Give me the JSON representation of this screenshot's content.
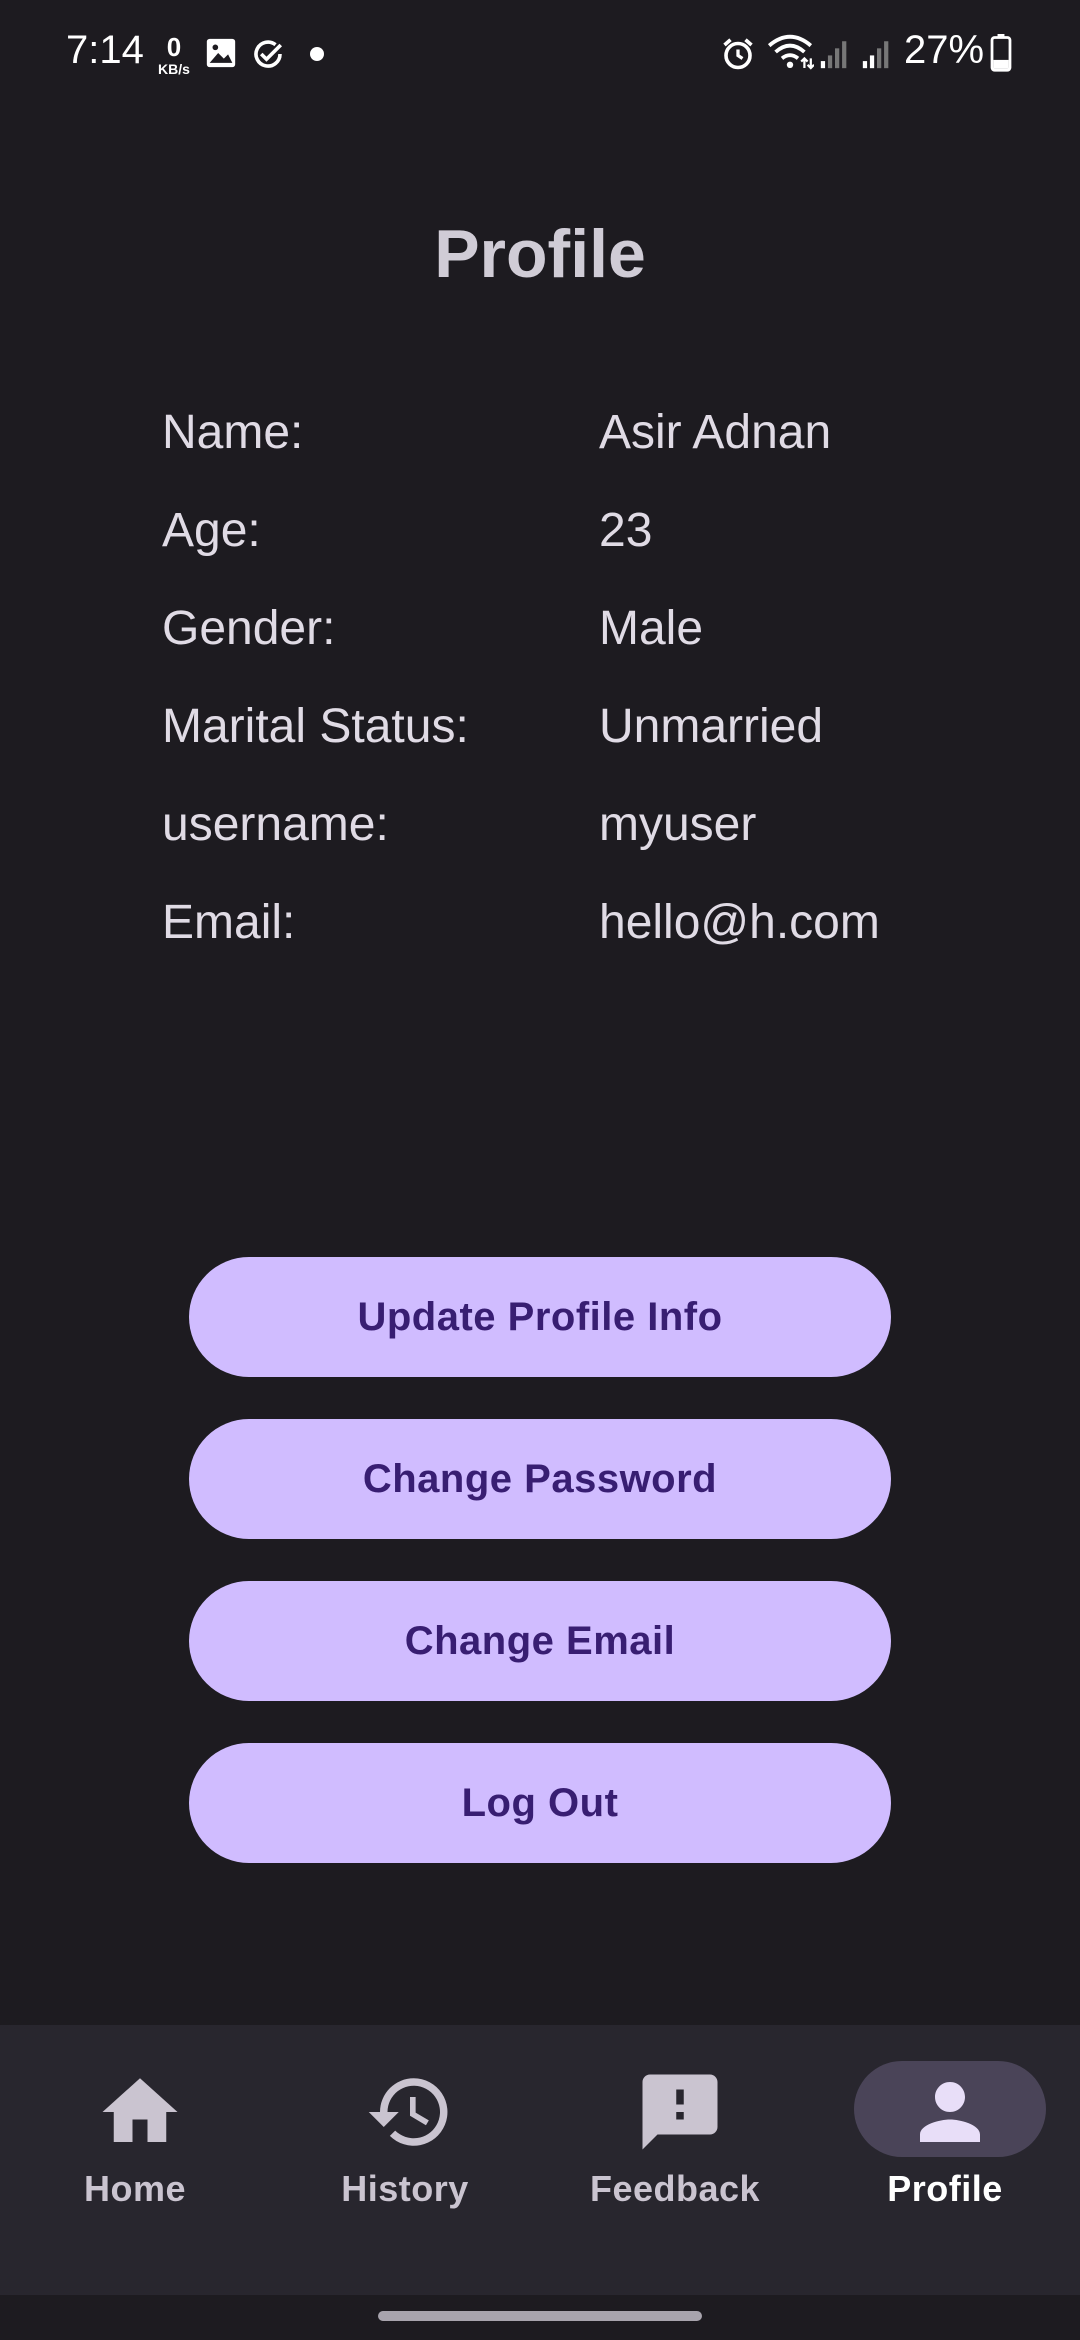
{
  "status_bar": {
    "time": "7:14",
    "net_speed_value": "0",
    "net_speed_unit": "KB/s",
    "battery": "27%",
    "icons": [
      "image-icon",
      "check-circle-icon",
      "dot-icon",
      "alarm-icon",
      "wifi-icon",
      "signal-icon",
      "signal-icon",
      "battery-icon"
    ]
  },
  "page": {
    "title": "Profile"
  },
  "profile": {
    "rows": [
      {
        "label": "Name:",
        "value": "Asir Adnan"
      },
      {
        "label": "Age:",
        "value": "23"
      },
      {
        "label": "Gender:",
        "value": "Male"
      },
      {
        "label": "Marital Status:",
        "value": "Unmarried"
      },
      {
        "label": "username:",
        "value": "myuser"
      },
      {
        "label": "Email:",
        "value": "hello@h.com"
      }
    ]
  },
  "actions": {
    "update_profile": "Update Profile Info",
    "change_password": "Change Password",
    "change_email": "Change Email",
    "log_out": "Log Out"
  },
  "bottom_nav": {
    "items": [
      {
        "label": "Home",
        "icon": "home-icon",
        "active": false
      },
      {
        "label": "History",
        "icon": "history-icon",
        "active": false
      },
      {
        "label": "Feedback",
        "icon": "feedback-icon",
        "active": false
      },
      {
        "label": "Profile",
        "icon": "person-icon",
        "active": true
      }
    ]
  },
  "colors": {
    "background": "#1d1b20",
    "button_bg": "#d0bcff",
    "button_text": "#381e72",
    "nav_bg": "#28262e",
    "nav_active_pill": "#4a4458"
  }
}
